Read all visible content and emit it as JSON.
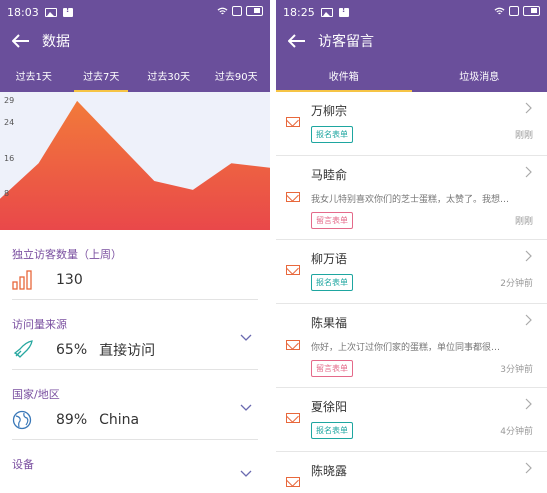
{
  "left": {
    "status_time": "18:03",
    "title": "数据",
    "tabs": [
      "过去1天",
      "过去7天",
      "过去30天",
      "过去90天"
    ],
    "active_tab": 1,
    "chart_data": {
      "type": "area",
      "y_ticks": [
        "29",
        "24",
        "16",
        "8"
      ],
      "x": [
        1,
        2,
        3,
        4,
        5,
        6,
        7,
        8
      ],
      "values": [
        7,
        15,
        29,
        20,
        11,
        9,
        15,
        14
      ],
      "ylim": [
        0,
        31
      ],
      "colors": {
        "top": "#f27a3a",
        "bottom": "#e9484a",
        "background": "#eef1fa"
      }
    },
    "stats": [
      {
        "label": "独立访客数量（上周）",
        "value": "130",
        "icon": "bar-chart-icon",
        "chevron": false
      },
      {
        "label": "访问量来源",
        "percent": "65%",
        "value": "直接访问",
        "icon": "rocket-icon",
        "chevron": true
      },
      {
        "label": "国家/地区",
        "percent": "89%",
        "value": "China",
        "icon": "globe-icon",
        "chevron": true
      },
      {
        "label": "设备",
        "chevron": true
      }
    ]
  },
  "right": {
    "status_time": "18:25",
    "title": "访客留言",
    "tabs": [
      "收件箱",
      "垃圾消息"
    ],
    "active_tab": 0,
    "messages": [
      {
        "name": "万柳宗",
        "preview": "",
        "tag": "报名表单",
        "tag_type": "green",
        "time": "刚刚"
      },
      {
        "name": "马睦俞",
        "preview": "我女儿特别喜欢你们的芝士蛋糕，太赞了。我想…",
        "tag": "留言表单",
        "tag_type": "pink",
        "time": "刚刚"
      },
      {
        "name": "柳万语",
        "preview": "",
        "tag": "报名表单",
        "tag_type": "green",
        "time": "2分钟前"
      },
      {
        "name": "陈果福",
        "preview": "你好，上次订过你们家的蛋糕，单位同事都很…",
        "tag": "留言表单",
        "tag_type": "pink",
        "time": "3分钟前"
      },
      {
        "name": "夏徐阳",
        "preview": "",
        "tag": "报名表单",
        "tag_type": "green",
        "time": "4分钟前"
      },
      {
        "name": "陈晓露",
        "preview": "",
        "tag": "",
        "tag_type": "",
        "time": ""
      }
    ]
  },
  "colors": {
    "header": "#6a4f9b",
    "accent_tab": "#f6c445",
    "label": "#7a4fa0",
    "envelope": "#e8683c"
  }
}
